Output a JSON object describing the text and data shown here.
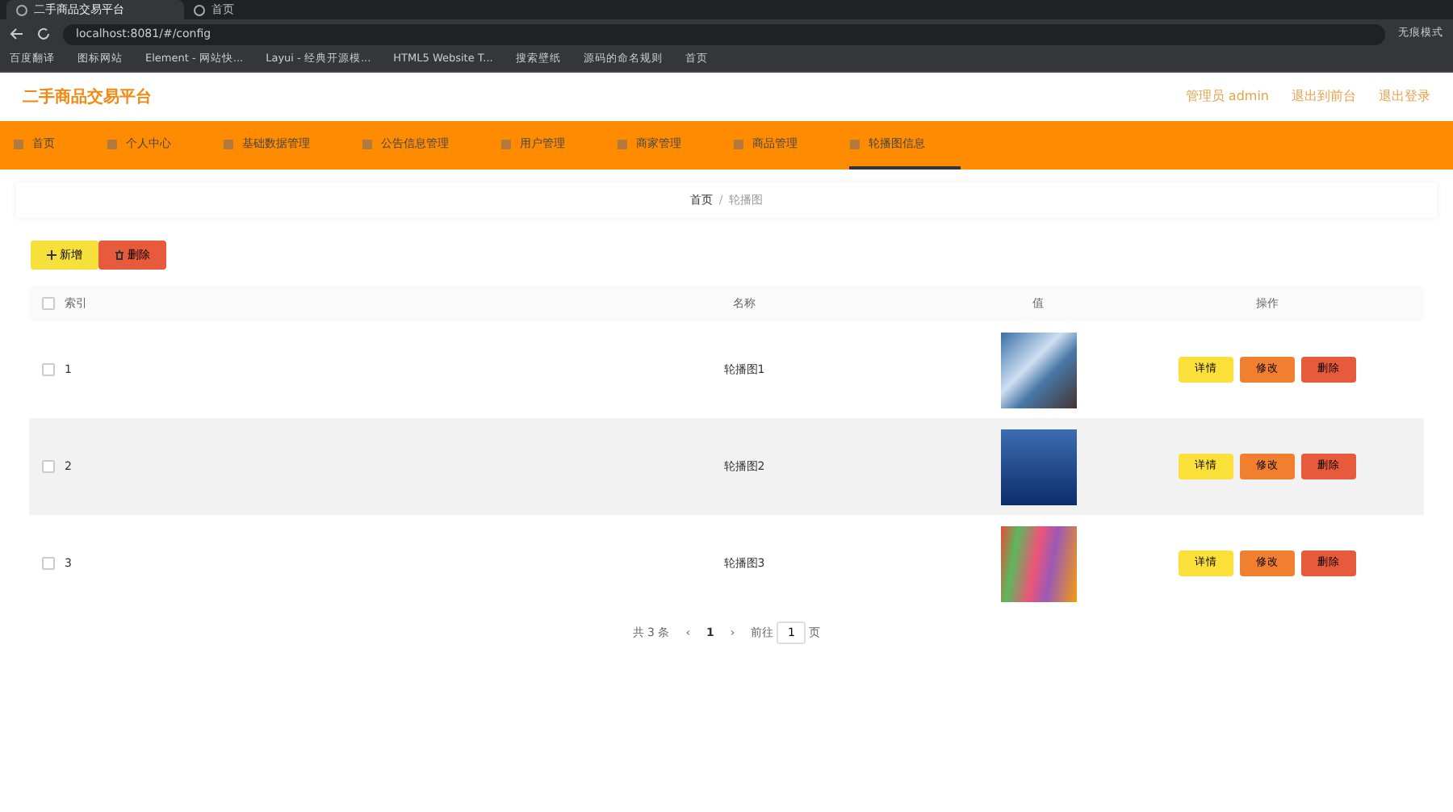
{
  "browser": {
    "tabs": [
      {
        "label": "二手商品交易平台",
        "selected": true
      },
      {
        "label": "首页",
        "selected": false
      }
    ],
    "address": "localhost:8081/#/config",
    "profile": "无痕模式",
    "bookmarks": [
      "百度翻译",
      "图标网站",
      "Element - 网站快...",
      "Layui - 经典开源模...",
      "HTML5 Website T...",
      "搜索壁纸",
      "源码的命名规则",
      "首页"
    ]
  },
  "header": {
    "title": "二手商品交易平台",
    "links": [
      "管理员 admin",
      "退出到前台",
      "退出登录"
    ]
  },
  "nav": [
    {
      "label": "首页",
      "selected": false
    },
    {
      "label": "个人中心",
      "selected": false
    },
    {
      "label": "基础数据管理",
      "selected": false
    },
    {
      "label": "公告信息管理",
      "selected": false
    },
    {
      "label": "用户管理",
      "selected": false
    },
    {
      "label": "商家管理",
      "selected": false
    },
    {
      "label": "商品管理",
      "selected": false
    },
    {
      "label": "轮播图信息",
      "selected": true
    }
  ],
  "breadcrumb": {
    "items": [
      "首页",
      "轮播图"
    ],
    "separator": "/"
  },
  "toolbar": [
    "新增",
    "删除"
  ],
  "table": {
    "select_all_checked": false,
    "columns": [
      "索引",
      "名称",
      "值",
      "操作"
    ],
    "rows": [
      {
        "index": "1",
        "name": "轮播图1",
        "highlighted": false,
        "checked": false,
        "actions": [
          "详情",
          "修改",
          "删除"
        ]
      },
      {
        "index": "2",
        "name": "轮播图2",
        "highlighted": true,
        "checked": false,
        "actions": [
          "详情",
          "修改",
          "删除"
        ]
      },
      {
        "index": "3",
        "name": "轮播图3",
        "highlighted": false,
        "checked": false,
        "actions": [
          "详情",
          "修改",
          "删除"
        ]
      }
    ]
  },
  "pagination": {
    "total": "共 3 条",
    "prev": "‹",
    "pages": [
      {
        "label": "1",
        "selected": true
      }
    ],
    "next": "›",
    "goto": "前往",
    "page_value": "1",
    "suffix": "页"
  }
}
